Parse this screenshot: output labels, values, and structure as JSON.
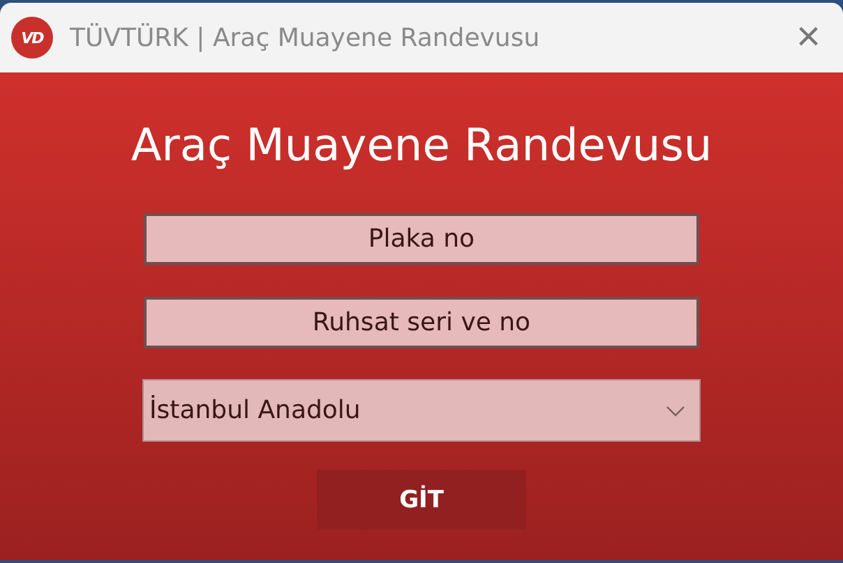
{
  "window": {
    "logo_text": "VD",
    "title": "TÜVTÜRK | Araç Muayene Randevusu",
    "close": "×"
  },
  "heading": "Araç Muayene Randevusu",
  "fields": [
    {
      "placeholder": "Plaka no"
    },
    {
      "placeholder": "Ruhsat seri ve no"
    }
  ],
  "dropdown": {
    "value": "İstanbul Anadolu"
  },
  "buttons": [
    "GİT"
  ]
}
